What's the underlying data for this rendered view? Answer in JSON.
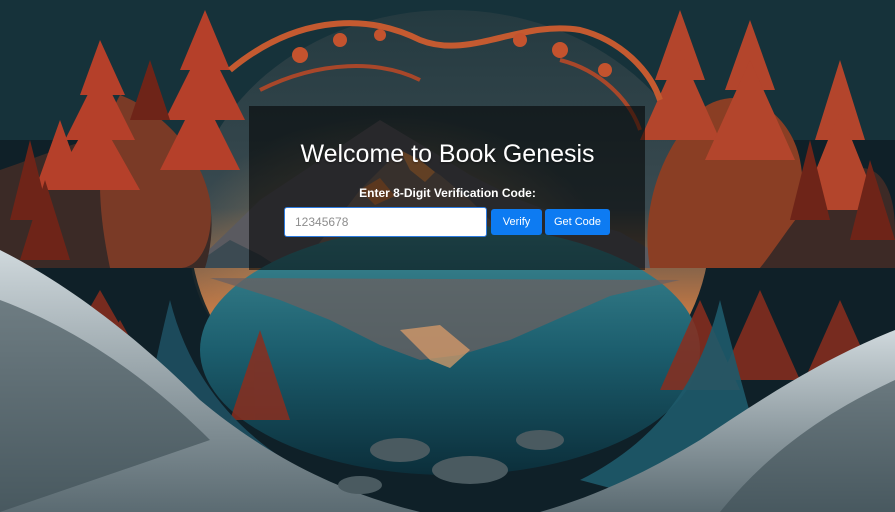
{
  "login": {
    "title": "Welcome to Book Genesis",
    "code_label": "Enter 8-Digit Verification Code:",
    "code_placeholder": "12345678",
    "verify_label": "Verify",
    "get_code_label": "Get Code"
  },
  "colors": {
    "button_bg": "#0d7bf2",
    "input_border": "#2d7be0",
    "panel_overlay": "rgba(0,0,0,0.55)"
  }
}
